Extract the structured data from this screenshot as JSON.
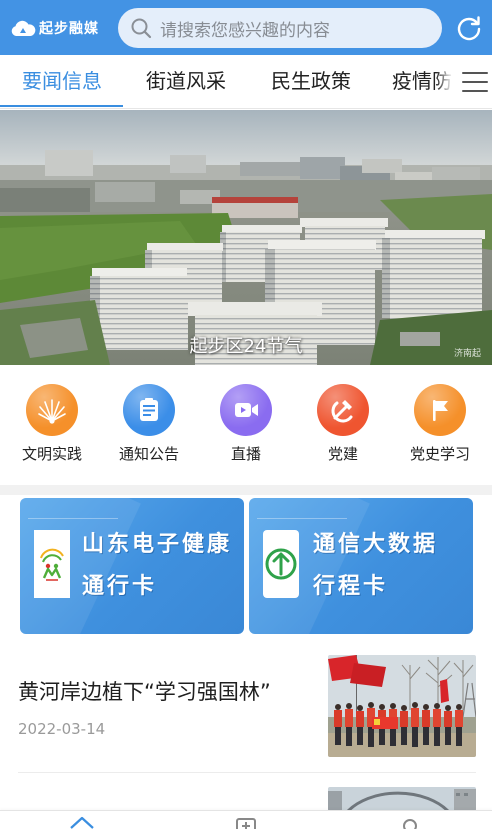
{
  "header": {
    "logo_text": "起步融媒",
    "logo_icon": "cloud-logo-icon",
    "search_placeholder": "请搜索您感兴趣的内容",
    "search_icon": "search-icon",
    "refresh_icon": "refresh-icon",
    "background_color": "#4393e4"
  },
  "tabs": {
    "items": [
      {
        "label": "要闻信息",
        "active": true
      },
      {
        "label": "街道风采",
        "active": false
      },
      {
        "label": "民生政策",
        "active": false
      },
      {
        "label": "疫情防",
        "active": false
      }
    ],
    "menu_icon": "menu-icon",
    "active_color": "#3a8ee0"
  },
  "hero": {
    "caption": "起步区24节气",
    "watermark": "济南起"
  },
  "shortcuts": [
    {
      "label": "文明实践",
      "icon": "fan-flower-icon",
      "color": "#f5902a"
    },
    {
      "label": "通知公告",
      "icon": "notice-icon",
      "color": "#3b8ee8"
    },
    {
      "label": "直播",
      "icon": "video-camera-icon",
      "color": "#8a6cf0"
    },
    {
      "label": "党建",
      "icon": "hammer-sickle-icon",
      "color": "#ef5530"
    },
    {
      "label": "党史学习",
      "icon": "flag-icon",
      "color": "#f5902a"
    }
  ],
  "banners": [
    {
      "line1": "山东电子健康",
      "line2": "通行卡",
      "icon": "health-pass-logo-icon"
    },
    {
      "line1": "通信大数据",
      "line2": "行程卡",
      "icon": "itinerary-arrow-icon"
    }
  ],
  "news": [
    {
      "title": "黄河岸边植下“学习强国林”",
      "date": "2022-03-14"
    }
  ],
  "bottom_nav": {
    "items": [
      {
        "icon": "home-icon",
        "active": true
      },
      {
        "icon": "add-square-icon",
        "active": false
      },
      {
        "icon": "user-icon",
        "active": false
      }
    ],
    "active_color": "#3a8ee0"
  }
}
